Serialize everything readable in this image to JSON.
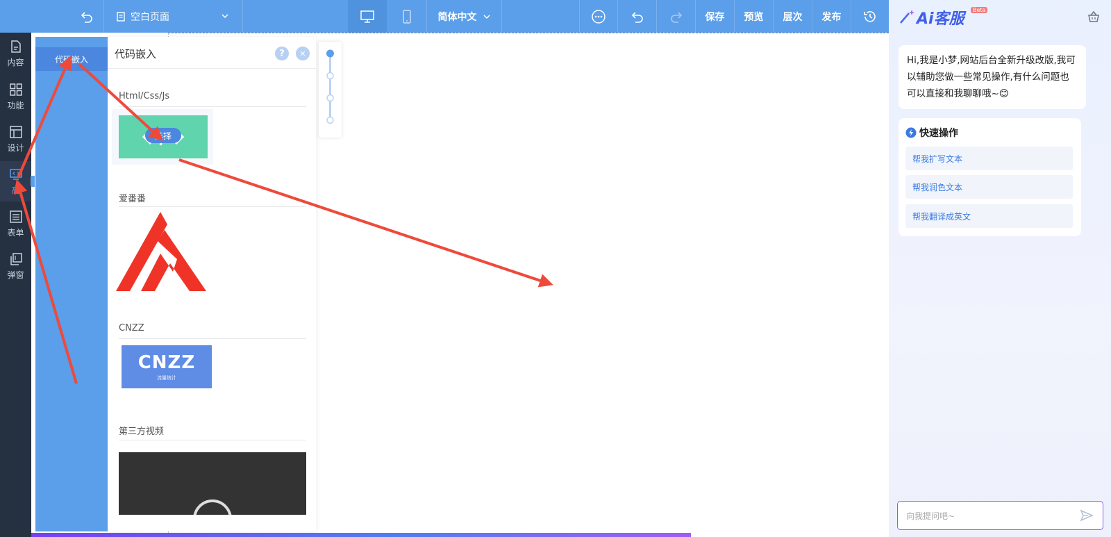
{
  "topbar": {
    "page_selector": "空白页面",
    "language": "简体中文",
    "save": "保存",
    "preview": "预览",
    "layers": "层次",
    "publish": "发布"
  },
  "rail": {
    "items": [
      {
        "label": "内容",
        "icon": "document-icon"
      },
      {
        "label": "功能",
        "icon": "grid-icon"
      },
      {
        "label": "设计",
        "icon": "layout-icon"
      },
      {
        "label": "高",
        "icon": "code-monitor-icon"
      },
      {
        "label": "表单",
        "icon": "list-icon"
      },
      {
        "label": "弹窗",
        "icon": "window-stack-icon"
      }
    ]
  },
  "category": {
    "active": "代码嵌入"
  },
  "panel": {
    "title": "代码嵌入",
    "help": "?",
    "close": "✕",
    "sections": [
      {
        "title": "Html/Css/Js",
        "select_label": "选择"
      },
      {
        "title": "爱番番"
      },
      {
        "title": "CNZZ",
        "logo_text": "CNZZ",
        "logo_sub": "流量统计"
      },
      {
        "title": "第三方视频"
      }
    ]
  },
  "ai": {
    "title": "Ai客服",
    "beta": "Beta",
    "greeting": "Hi,我是小梦,网站后台全新升级改版,我可以辅助您做一些常见操作,有什么问题也可以直接和我聊聊哦~😊",
    "quick_title": "快速操作",
    "quick_items": [
      "帮我扩写文本",
      "帮我润色文本",
      "帮我翻译成英文"
    ],
    "input_placeholder": "向我提问吧~"
  },
  "colors": {
    "topbar": "#5b9ee9",
    "rail": "#253041",
    "accent": "#3a7be0",
    "annotation": "#ee4a3c",
    "aifanfan": "#ef3427",
    "html_tile": "#5fd4ad",
    "cnzz_tile": "#5f8de6"
  }
}
